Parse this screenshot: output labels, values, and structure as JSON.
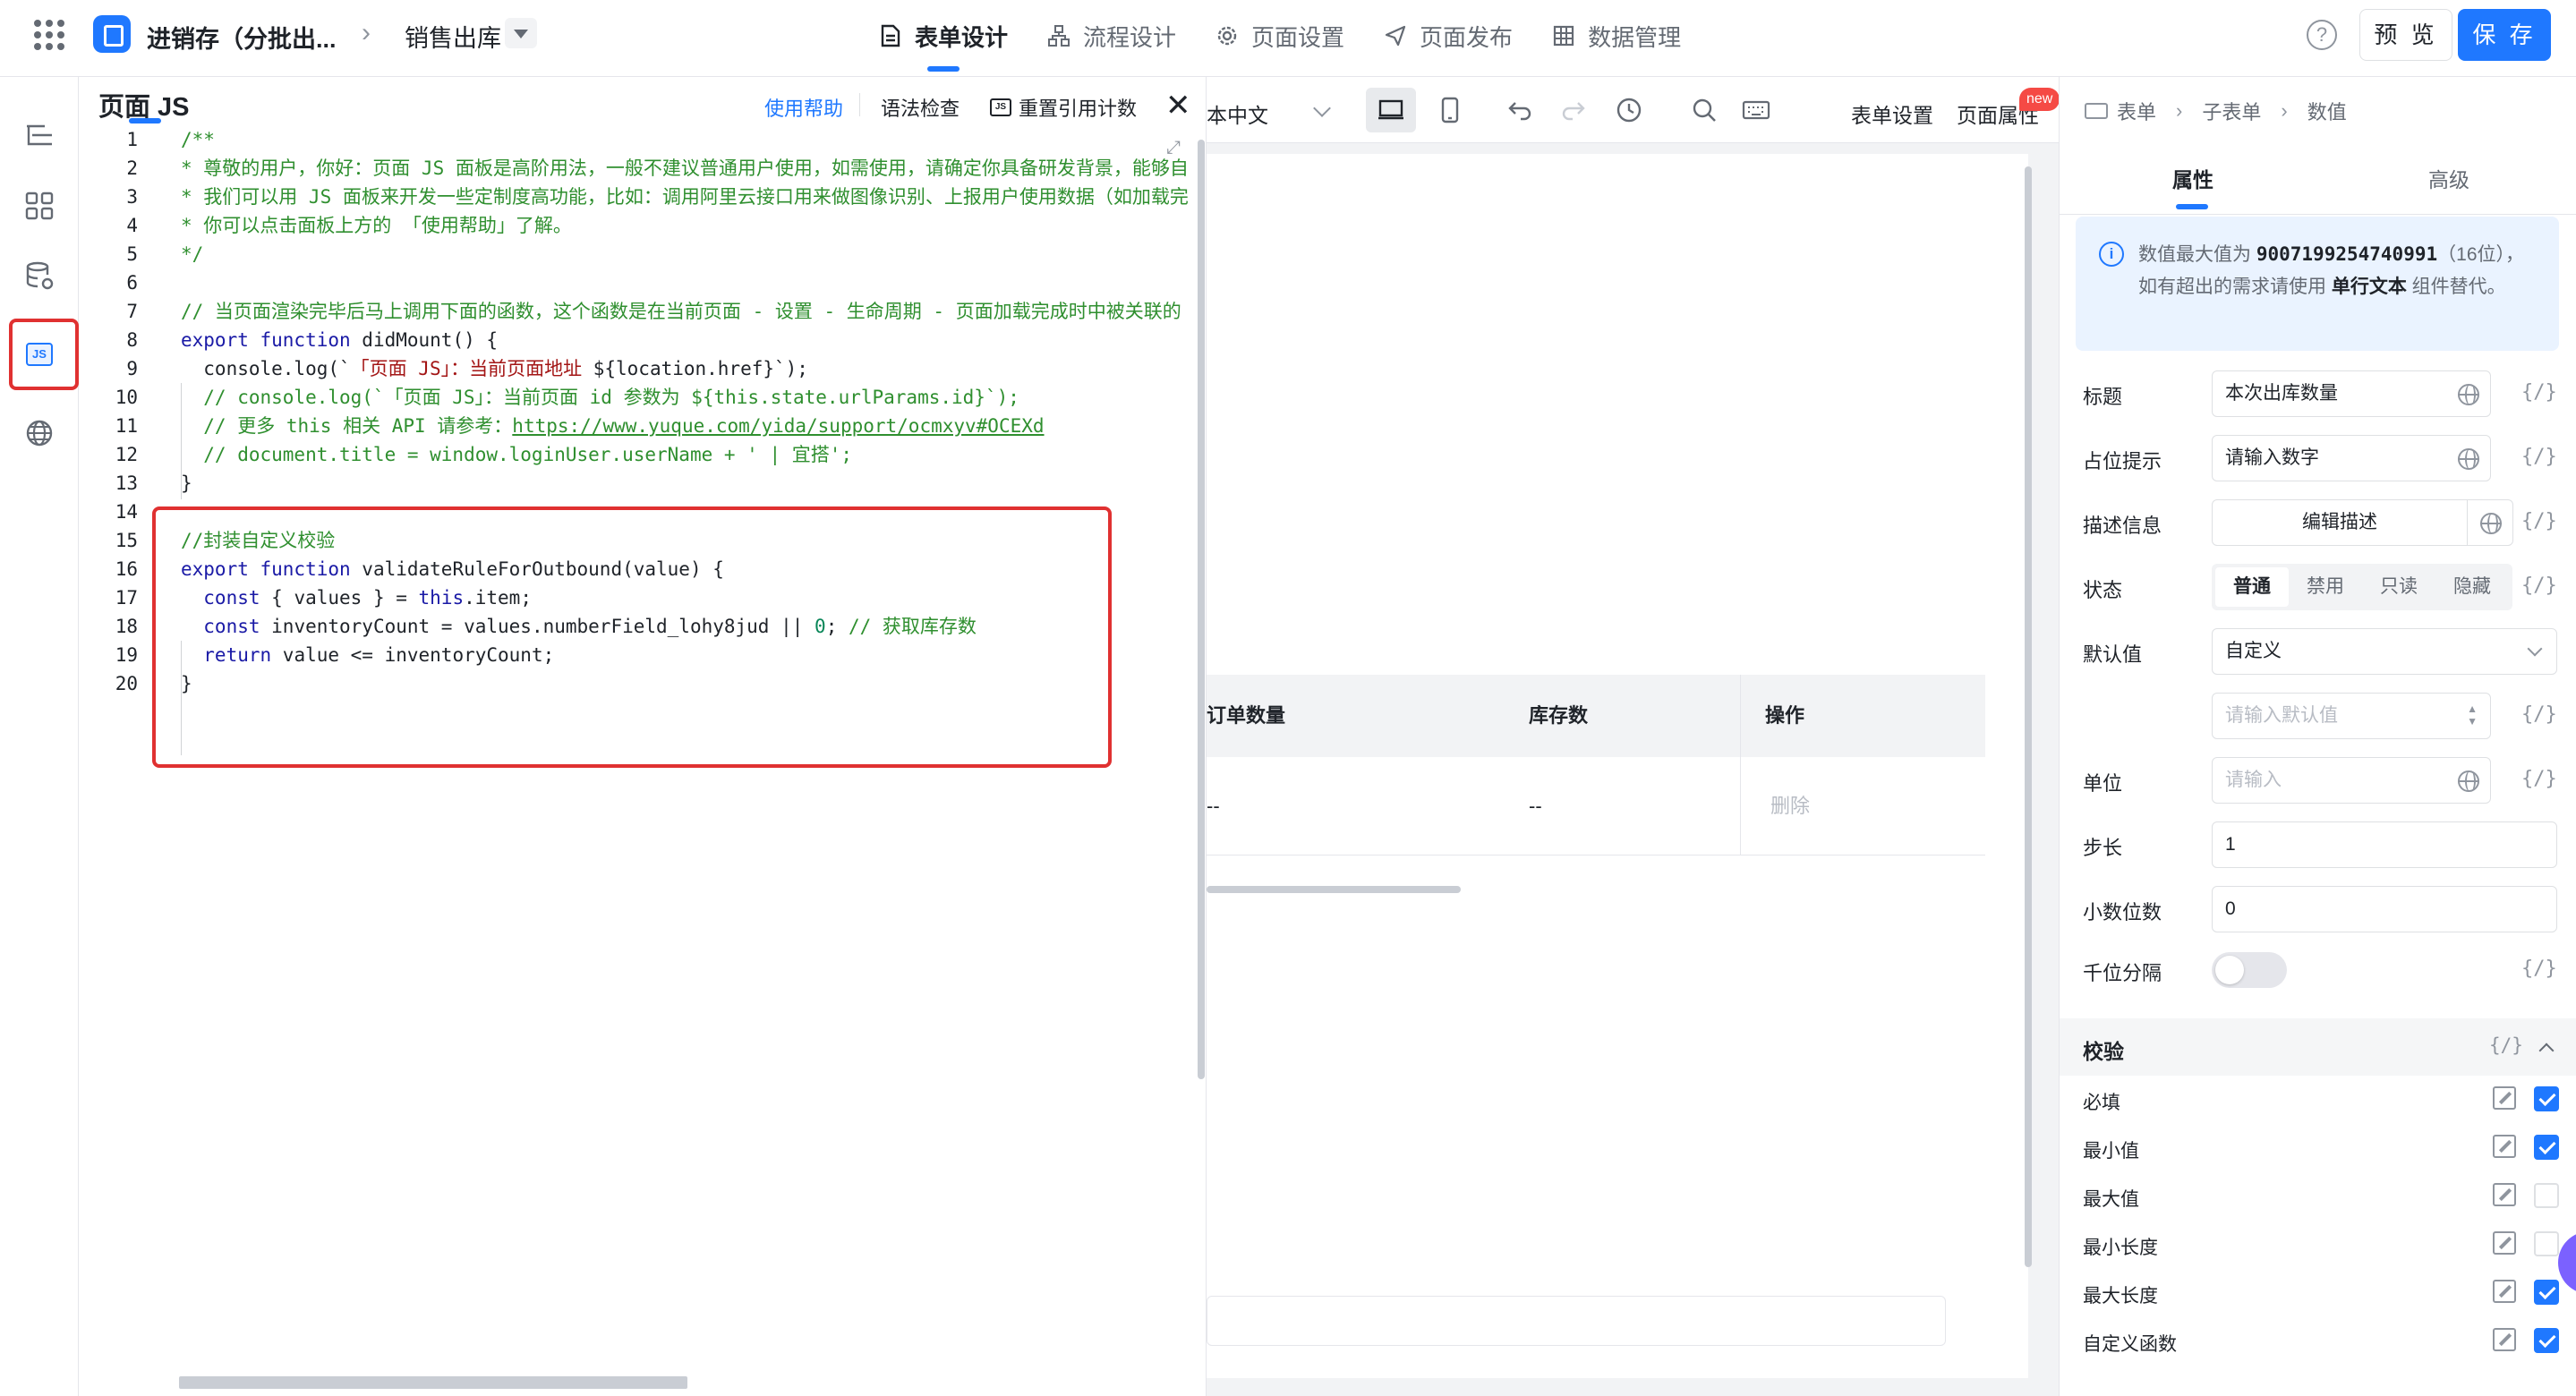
{
  "colors": {
    "brand": "#1f78ff",
    "highlight": "#e03131",
    "badge": "#f54a45"
  },
  "topnav": {
    "app_name": "进销存（分批出...",
    "page_name": "销售出库",
    "tabs": [
      {
        "label": "表单设计",
        "icon": "document-icon"
      },
      {
        "label": "流程设计",
        "icon": "flow-icon"
      },
      {
        "label": "页面设置",
        "icon": "gear-icon"
      },
      {
        "label": "页面发布",
        "icon": "send-icon"
      },
      {
        "label": "数据管理",
        "icon": "table-icon"
      }
    ],
    "help_glyph": "?",
    "preview_label": "预 览",
    "save_label": "保 存"
  },
  "rail": {
    "js_label": "JS"
  },
  "js_panel": {
    "title": "页面 JS",
    "help_link": "使用帮助",
    "lint_label": "语法检查",
    "reset_label": "重置引用计数",
    "reset_icon_text": "JS",
    "close_glyph": "✕",
    "line_numbers": [
      "1",
      "2",
      "3",
      "4",
      "5",
      "6",
      "7",
      "8",
      "9",
      "10",
      "11",
      "12",
      "13",
      "14",
      "15",
      "16",
      "17",
      "18",
      "19",
      "20"
    ],
    "lines": {
      "l1": "/**",
      "l2": "* 尊敬的用户，你好：页面 JS 面板是高阶用法，一般不建议普通用户使用，如需使用，请确定你具备研发背景，能够自",
      "l3": "* 我们可以用 JS 面板来开发一些定制度高功能，比如：调用阿里云接口用来做图像识别、上报用户使用数据（如加载完",
      "l4": "* 你可以点击面板上方的 「使用帮助」了解。",
      "l5": "*/",
      "l7": "// 当页面渲染完毕后马上调用下面的函数，这个函数是在当前页面 - 设置 - 生命周期 - 页面加载完成时中被关联的",
      "l8_kw": "export function",
      "l8_rest": " didMount() {",
      "l9_pre": "  console.log(`",
      "l9_str": "「页面 JS」：当前页面地址",
      "l9_post": " ${location.href}`);",
      "l10": "  // console.log(`「页面 JS」：当前页面 id 参数为 ${this.state.urlParams.id}`);",
      "l11_pre": "  // 更多 this 相关 API 请参考：",
      "l11_link": "https://www.yuque.com/yida/support/ocmxyv#OCEXd",
      "l12": "  // document.title = window.loginUser.userName + ' | 宜搭';",
      "l13": "}",
      "l15": "//封装自定义校验",
      "l16_kw": "export function",
      "l16_rest": " validateRuleForOutbound(value) {",
      "l17_kw": "  const",
      "l17_mid": " { values } = ",
      "l17_kw2": "this",
      "l17_rest": ".item;",
      "l18_kw": "  const",
      "l18_mid": " inventoryCount = values.numberField_lohy8jud || ",
      "l18_num": "0",
      "l18_semi": "; ",
      "l18_com": "// 获取库存数",
      "l19_kw": "  return",
      "l19_rest": " value <= inventoryCount;",
      "l20": "}"
    }
  },
  "canvas": {
    "lang_label": "本中文",
    "form_settings": "表单设置",
    "page_props": "页面属性",
    "new_badge": "new",
    "table_headers": [
      "订单数量",
      "库存数",
      "操作"
    ],
    "table_row": [
      "--",
      "--",
      "删除"
    ]
  },
  "props": {
    "breadcrumb": [
      "表单",
      "子表单",
      "数值"
    ],
    "tabs": [
      "属性",
      "高级"
    ],
    "info": {
      "prefix": "数值最大值为 ",
      "max_value": "9007199254740991",
      "middle": "（16位），如有超出的需求请使用 ",
      "component": "单行文本",
      "suffix": " 组件替代。"
    },
    "fx": "{/}",
    "fields": {
      "title_label": "标题",
      "title_value": "本次出库数量",
      "placeholder_label": "占位提示",
      "placeholder_value": "请输入数字",
      "desc_label": "描述信息",
      "desc_button": "编辑描述",
      "state_label": "状态",
      "state_options": [
        "普通",
        "禁用",
        "只读",
        "隐藏"
      ],
      "default_label": "默认值",
      "default_value": "自定义",
      "default_placeholder": "请输入默认值",
      "unit_label": "单位",
      "unit_placeholder": "请输入",
      "step_label": "步长",
      "step_value": "1",
      "decimal_label": "小数位数",
      "decimal_value": "0",
      "thousands_label": "千位分隔",
      "thousands_on": false
    },
    "validation": {
      "title": "校验",
      "rules": [
        {
          "label": "必填",
          "checked": true
        },
        {
          "label": "最小值",
          "checked": true
        },
        {
          "label": "最大值",
          "checked": false
        },
        {
          "label": "最小长度",
          "checked": false
        },
        {
          "label": "最大长度",
          "checked": true
        },
        {
          "label": "自定义函数",
          "checked": true
        }
      ]
    }
  }
}
